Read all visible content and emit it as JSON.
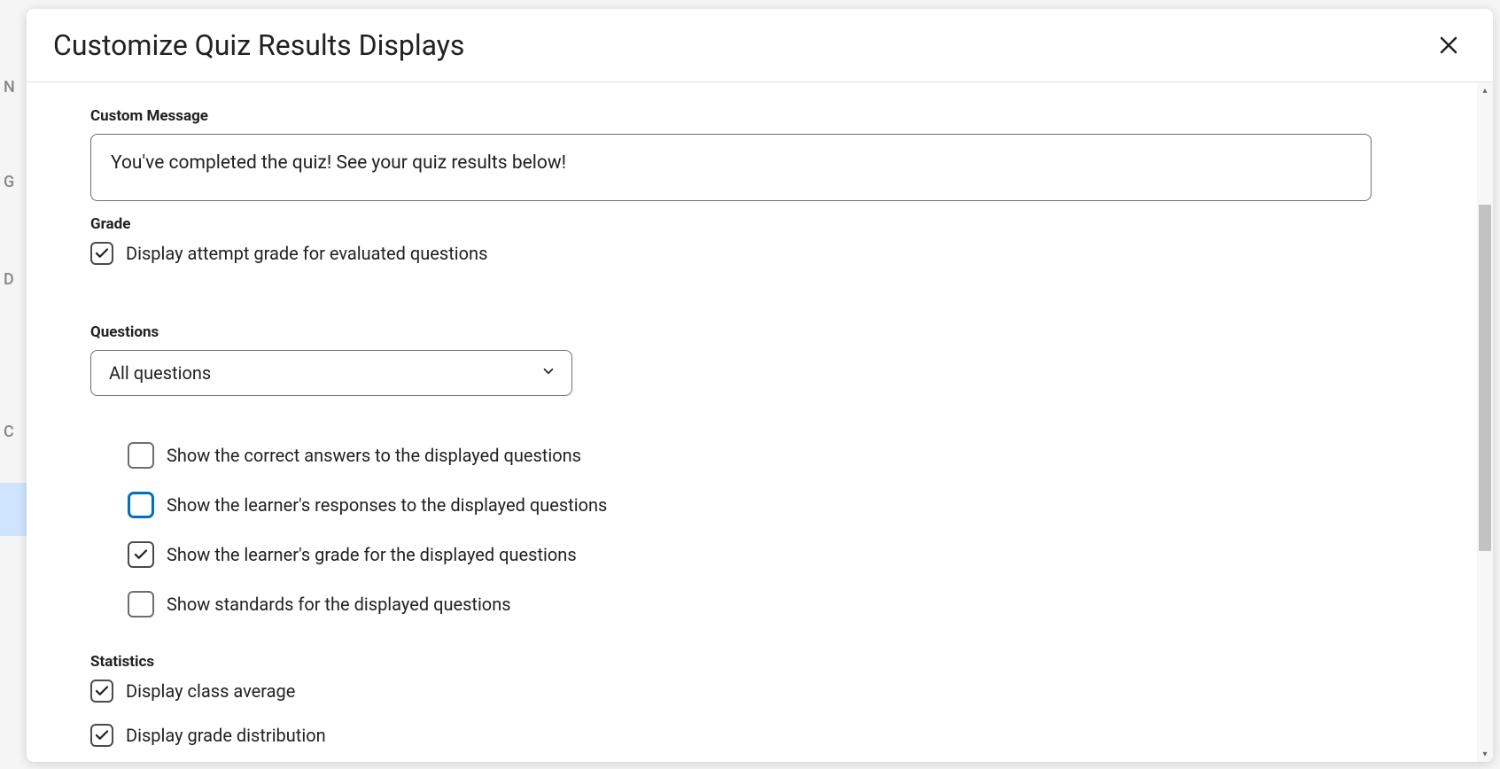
{
  "modal": {
    "title": "Customize Quiz Results Displays"
  },
  "sections": {
    "custom_message": {
      "label": "Custom Message",
      "value": "You've completed the quiz! See your quiz results below!"
    },
    "grade": {
      "label": "Grade",
      "display_attempt_grade": {
        "label": "Display attempt grade for evaluated questions",
        "checked": true
      }
    },
    "questions": {
      "label": "Questions",
      "select": {
        "selected": "All questions"
      },
      "options": {
        "show_correct_answers": {
          "label": "Show the correct answers to the displayed questions",
          "checked": false
        },
        "show_learner_responses": {
          "label": "Show the learner's responses to the displayed questions",
          "checked": false,
          "focused": true
        },
        "show_learner_grade": {
          "label": "Show the learner's grade for the displayed questions",
          "checked": true
        },
        "show_standards": {
          "label": "Show standards for the displayed questions",
          "checked": false
        }
      }
    },
    "statistics": {
      "label": "Statistics",
      "display_class_average": {
        "label": "Display class average",
        "checked": true
      },
      "display_grade_distribution": {
        "label": "Display grade distribution",
        "checked": true
      }
    }
  },
  "background": {
    "letters": [
      "N",
      "G",
      "D",
      "C"
    ]
  },
  "scrollbar": {
    "thumb_top_pct": 18,
    "thumb_height_pct": 51
  }
}
